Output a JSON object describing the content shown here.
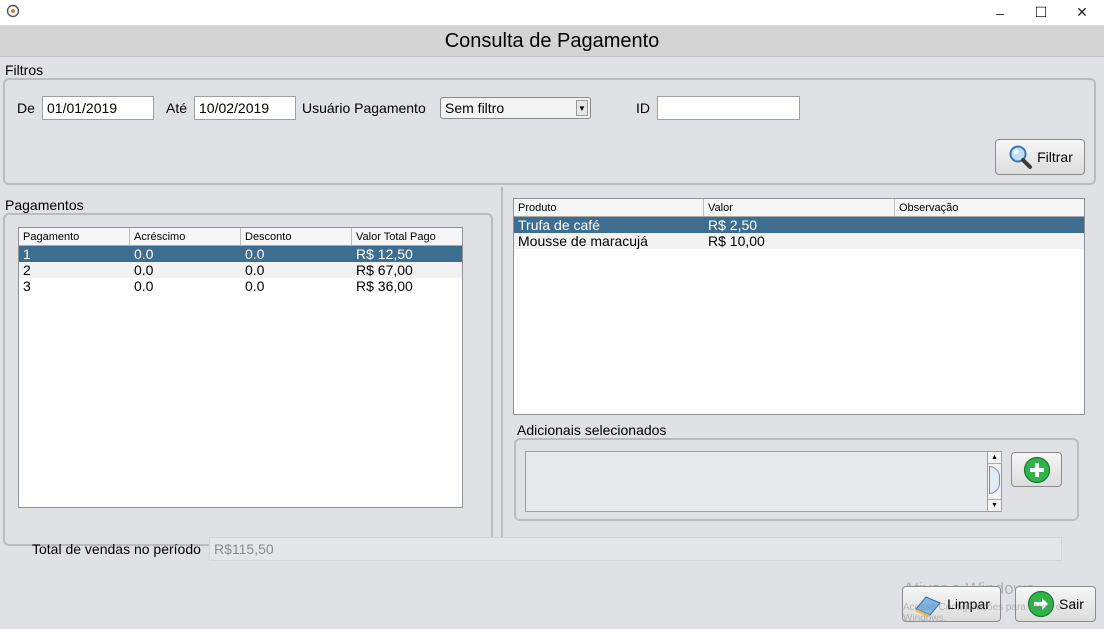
{
  "window": {
    "minimize_glyph": "–",
    "maximize_glyph": "☐",
    "close_glyph": "✕"
  },
  "header": {
    "title": "Consulta de Pagamento"
  },
  "filters": {
    "section_label": "Filtros",
    "from_label": "De",
    "from_value": "01/01/2019",
    "to_label": "Até",
    "to_value": "10/02/2019",
    "user_label": "Usuário Pagamento",
    "user_select_value": "Sem filtro",
    "id_label": "ID",
    "id_value": "",
    "filter_button": "Filtrar"
  },
  "payments": {
    "section_label": "Pagamentos",
    "columns": [
      "Pagamento",
      "Acréscimo",
      "Desconto",
      "Valor Total Pago"
    ],
    "rows": [
      [
        "1",
        "0.0",
        "0.0",
        "R$ 12,50"
      ],
      [
        "2",
        "0.0",
        "0.0",
        "R$ 67,00"
      ],
      [
        "3",
        "0.0",
        "0.0",
        "R$ 36,00"
      ]
    ],
    "selected_row": 0
  },
  "products": {
    "columns": [
      "Produto",
      "Valor",
      "Observação"
    ],
    "rows": [
      [
        "Trufa de café",
        "R$ 2,50",
        ""
      ],
      [
        "Mousse de maracujá",
        "R$ 10,00",
        ""
      ]
    ],
    "selected_row": 0
  },
  "extras": {
    "section_label": "Adicionais selecionados"
  },
  "footer": {
    "total_label": "Total de vendas no período",
    "total_value": "R$115,50",
    "clear_button": "Limpar",
    "exit_button": "Sair"
  },
  "watermark": {
    "line1": "Ativar o Windows",
    "line2": "Acesse Configurações para ativar o Windows."
  },
  "colors": {
    "selected_row": "#3d6e8f",
    "panel_bg": "#dfe1e5",
    "header_bg": "#d4d4d4",
    "add_icon_green": "#2fb34a",
    "exit_icon_green": "#2fb34a"
  }
}
